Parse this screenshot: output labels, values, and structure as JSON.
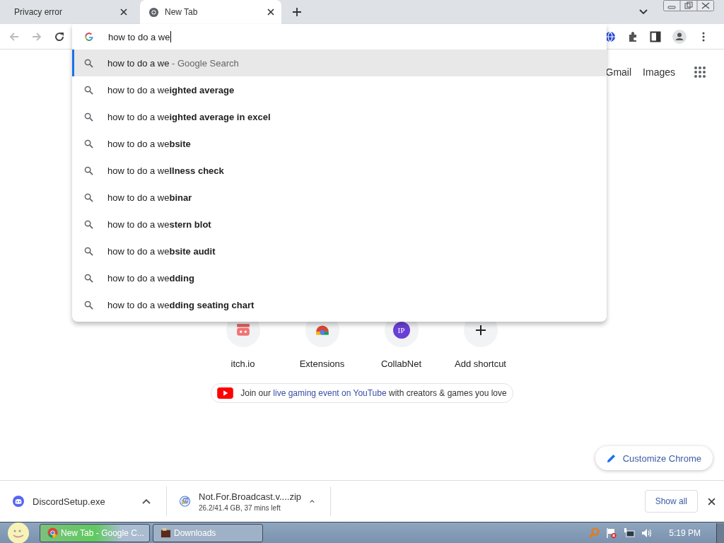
{
  "tabs": [
    {
      "title": "Privacy error",
      "selected": false,
      "favicon": false
    },
    {
      "title": "New Tab",
      "selected": true,
      "favicon": true
    }
  ],
  "omnibox": {
    "value": "how to do a we"
  },
  "suggestions": [
    {
      "kind": "what-you-typed",
      "text": "how to do a we",
      "hint": "- Google Search",
      "selected": true
    },
    {
      "kind": "suggestion",
      "text": "how to do a we**ighted average**",
      "selected": false
    },
    {
      "kind": "suggestion",
      "text": "how to do a we**ighted average in excel**",
      "selected": false
    },
    {
      "kind": "suggestion",
      "text": "how to do a we**bsite**",
      "selected": false
    },
    {
      "kind": "suggestion",
      "text": "how to do a we**llness check**",
      "selected": false
    },
    {
      "kind": "suggestion",
      "text": "how to do a we**binar**",
      "selected": false
    },
    {
      "kind": "suggestion",
      "text": "how to do a we**stern blot**",
      "selected": false
    },
    {
      "kind": "suggestion",
      "text": "how to do a we**bsite audit**",
      "selected": false
    },
    {
      "kind": "suggestion",
      "text": "how to do a we**dding**",
      "selected": false
    },
    {
      "kind": "suggestion",
      "text": "how to do a we**dding seating chart**",
      "selected": false
    }
  ],
  "header_links": [
    "Gmail",
    "Images"
  ],
  "shortcuts": [
    {
      "kind": "gamepad",
      "label": "itch.io"
    },
    {
      "kind": "chrome",
      "label": "Extensions"
    },
    {
      "kind": "letters",
      "badge": "IP",
      "label": "CollabNet"
    },
    {
      "kind": "add",
      "label": "Add shortcut"
    }
  ],
  "promo": {
    "before": "Join our ",
    "link": "live gaming event on YouTube",
    "after": " with creators & games you love"
  },
  "customize_button": "Customize Chrome",
  "downloads": [
    {
      "kind": "discord",
      "name": "DiscordSetup.exe"
    },
    {
      "kind": "zip",
      "name": "Not.For.Broadcast.v....zip",
      "status": "26.2/41.4 GB, 37 mins left"
    }
  ],
  "show_all": "Show all",
  "taskbar": {
    "tasks": [
      {
        "title": "New Tab - Google C...",
        "kind": "chrome",
        "selected": true
      },
      {
        "title": "Downloads",
        "kind": "folder",
        "selected": false
      }
    ],
    "time": "5:19 PM"
  }
}
